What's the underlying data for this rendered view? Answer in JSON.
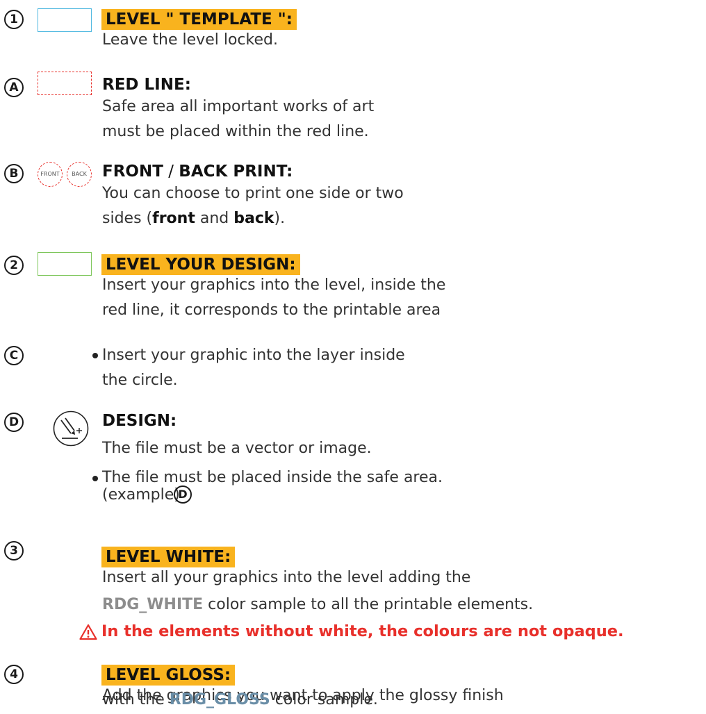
{
  "sections": {
    "s1": {
      "badge": "1",
      "heading": "LEVEL \" TEMPLATE \":",
      "line1": "Leave the level locked.",
      "swatch_color": "#4fb8e0"
    },
    "sA": {
      "badge": "A",
      "heading": "RED LINE:",
      "line1": "Safe area all important works of art",
      "line2": "must be placed within the red line.",
      "swatch_color": "#e8302b"
    },
    "sB": {
      "badge": "B",
      "front_label": "FRONT",
      "back_label": "BACK",
      "heading_front": "FRONT",
      "heading_sep": " / ",
      "heading_back": "BACK PRINT:",
      "line1": "You can choose to print one side or two",
      "line2_pre": "sides (",
      "line2_front": "front",
      "line2_mid": " and ",
      "line2_back": "back",
      "line2_post": ")."
    },
    "s2": {
      "badge": "2",
      "heading": "LEVEL YOUR DESIGN:",
      "line1": "Insert your graphics into the level, inside the",
      "line2": "red line, it corresponds to the printable area",
      "swatch_color": "#7dc65a"
    },
    "sC": {
      "badge": "C",
      "line1": "Insert your graphic into the layer inside",
      "line2": "the circle."
    },
    "sD": {
      "badge": "D",
      "heading": "DESIGN:",
      "line1": "The file must be a vector or image.",
      "line2": "The file must be placed inside the safe area.",
      "line3": "(example)",
      "inline_badge": "D",
      "icon": "design-pen-icon"
    },
    "s3": {
      "badge": "3",
      "heading": "LEVEL WHITE:",
      "line1": "Insert all your graphics into the level adding the",
      "line2_strong": "RDG_WHITE",
      "line2_rest": " color sample to all the printable elements.",
      "warning": "In the elements without white, the colours are not opaque.",
      "warning_icon": "warning-triangle-icon"
    },
    "s4": {
      "badge": "4",
      "heading": "LEVEL GLOSS:",
      "line1": "Add the graphics you want to apply the glossy finish",
      "line2_pre": "with the ",
      "line2_strong": "RDG_GLOSS",
      "line2_post": " color sample."
    }
  },
  "colors": {
    "highlight": "#f9b31e",
    "warning": "#e8302b",
    "white_sample": "#8d8d8d",
    "gloss_sample": "#6a8ea7"
  }
}
